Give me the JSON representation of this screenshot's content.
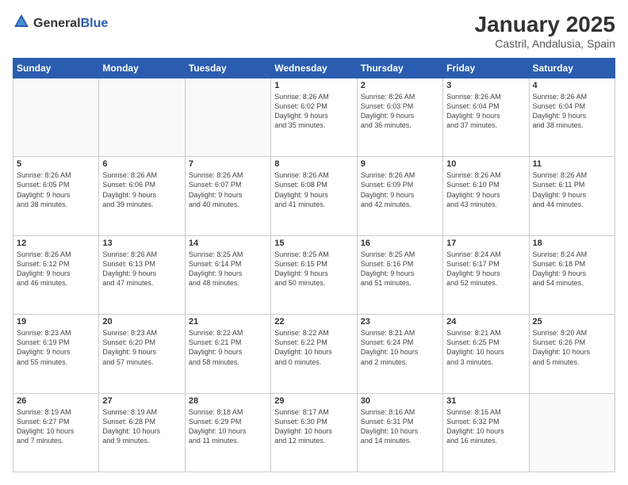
{
  "logo": {
    "general": "General",
    "blue": "Blue"
  },
  "title": "January 2025",
  "subtitle": "Castril, Andalusia, Spain",
  "days_of_week": [
    "Sunday",
    "Monday",
    "Tuesday",
    "Wednesday",
    "Thursday",
    "Friday",
    "Saturday"
  ],
  "weeks": [
    [
      {
        "day": "",
        "info": ""
      },
      {
        "day": "",
        "info": ""
      },
      {
        "day": "",
        "info": ""
      },
      {
        "day": "1",
        "info": "Sunrise: 8:26 AM\nSunset: 6:02 PM\nDaylight: 9 hours\nand 35 minutes."
      },
      {
        "day": "2",
        "info": "Sunrise: 8:26 AM\nSunset: 6:03 PM\nDaylight: 9 hours\nand 36 minutes."
      },
      {
        "day": "3",
        "info": "Sunrise: 8:26 AM\nSunset: 6:04 PM\nDaylight: 9 hours\nand 37 minutes."
      },
      {
        "day": "4",
        "info": "Sunrise: 8:26 AM\nSunset: 6:04 PM\nDaylight: 9 hours\nand 38 minutes."
      }
    ],
    [
      {
        "day": "5",
        "info": "Sunrise: 8:26 AM\nSunset: 6:05 PM\nDaylight: 9 hours\nand 38 minutes."
      },
      {
        "day": "6",
        "info": "Sunrise: 8:26 AM\nSunset: 6:06 PM\nDaylight: 9 hours\nand 39 minutes."
      },
      {
        "day": "7",
        "info": "Sunrise: 8:26 AM\nSunset: 6:07 PM\nDaylight: 9 hours\nand 40 minutes."
      },
      {
        "day": "8",
        "info": "Sunrise: 8:26 AM\nSunset: 6:08 PM\nDaylight: 9 hours\nand 41 minutes."
      },
      {
        "day": "9",
        "info": "Sunrise: 8:26 AM\nSunset: 6:09 PM\nDaylight: 9 hours\nand 42 minutes."
      },
      {
        "day": "10",
        "info": "Sunrise: 8:26 AM\nSunset: 6:10 PM\nDaylight: 9 hours\nand 43 minutes."
      },
      {
        "day": "11",
        "info": "Sunrise: 8:26 AM\nSunset: 6:11 PM\nDaylight: 9 hours\nand 44 minutes."
      }
    ],
    [
      {
        "day": "12",
        "info": "Sunrise: 8:26 AM\nSunset: 6:12 PM\nDaylight: 9 hours\nand 46 minutes."
      },
      {
        "day": "13",
        "info": "Sunrise: 8:26 AM\nSunset: 6:13 PM\nDaylight: 9 hours\nand 47 minutes."
      },
      {
        "day": "14",
        "info": "Sunrise: 8:25 AM\nSunset: 6:14 PM\nDaylight: 9 hours\nand 48 minutes."
      },
      {
        "day": "15",
        "info": "Sunrise: 8:25 AM\nSunset: 6:15 PM\nDaylight: 9 hours\nand 50 minutes."
      },
      {
        "day": "16",
        "info": "Sunrise: 8:25 AM\nSunset: 6:16 PM\nDaylight: 9 hours\nand 51 minutes."
      },
      {
        "day": "17",
        "info": "Sunrise: 8:24 AM\nSunset: 6:17 PM\nDaylight: 9 hours\nand 52 minutes."
      },
      {
        "day": "18",
        "info": "Sunrise: 8:24 AM\nSunset: 6:18 PM\nDaylight: 9 hours\nand 54 minutes."
      }
    ],
    [
      {
        "day": "19",
        "info": "Sunrise: 8:23 AM\nSunset: 6:19 PM\nDaylight: 9 hours\nand 55 minutes."
      },
      {
        "day": "20",
        "info": "Sunrise: 8:23 AM\nSunset: 6:20 PM\nDaylight: 9 hours\nand 57 minutes."
      },
      {
        "day": "21",
        "info": "Sunrise: 8:22 AM\nSunset: 6:21 PM\nDaylight: 9 hours\nand 58 minutes."
      },
      {
        "day": "22",
        "info": "Sunrise: 8:22 AM\nSunset: 6:22 PM\nDaylight: 10 hours\nand 0 minutes."
      },
      {
        "day": "23",
        "info": "Sunrise: 8:21 AM\nSunset: 6:24 PM\nDaylight: 10 hours\nand 2 minutes."
      },
      {
        "day": "24",
        "info": "Sunrise: 8:21 AM\nSunset: 6:25 PM\nDaylight: 10 hours\nand 3 minutes."
      },
      {
        "day": "25",
        "info": "Sunrise: 8:20 AM\nSunset: 6:26 PM\nDaylight: 10 hours\nand 5 minutes."
      }
    ],
    [
      {
        "day": "26",
        "info": "Sunrise: 8:19 AM\nSunset: 6:27 PM\nDaylight: 10 hours\nand 7 minutes."
      },
      {
        "day": "27",
        "info": "Sunrise: 8:19 AM\nSunset: 6:28 PM\nDaylight: 10 hours\nand 9 minutes."
      },
      {
        "day": "28",
        "info": "Sunrise: 8:18 AM\nSunset: 6:29 PM\nDaylight: 10 hours\nand 11 minutes."
      },
      {
        "day": "29",
        "info": "Sunrise: 8:17 AM\nSunset: 6:30 PM\nDaylight: 10 hours\nand 12 minutes."
      },
      {
        "day": "30",
        "info": "Sunrise: 8:16 AM\nSunset: 6:31 PM\nDaylight: 10 hours\nand 14 minutes."
      },
      {
        "day": "31",
        "info": "Sunrise: 8:16 AM\nSunset: 6:32 PM\nDaylight: 10 hours\nand 16 minutes."
      },
      {
        "day": "",
        "info": ""
      }
    ]
  ]
}
